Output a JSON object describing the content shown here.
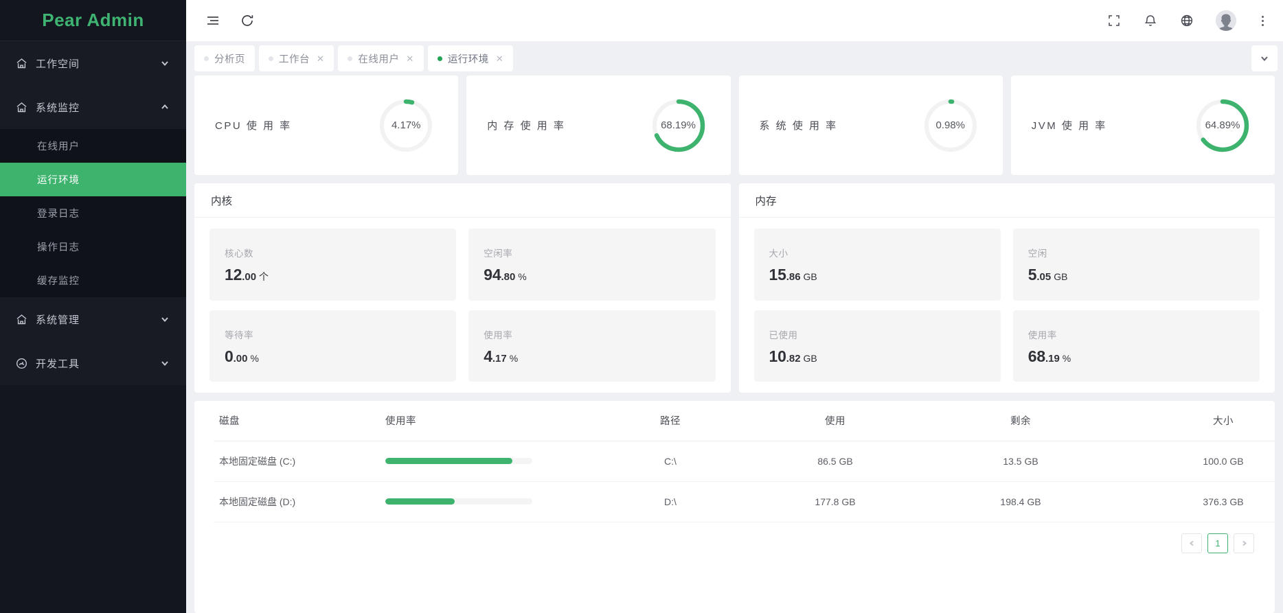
{
  "brand": {
    "name": "Pear Admin"
  },
  "sidebar": {
    "groups": [
      {
        "label": "工作空间",
        "icon": "home-icon",
        "expanded": false,
        "items": []
      },
      {
        "label": "系统监控",
        "icon": "home-icon",
        "expanded": true,
        "items": [
          {
            "label": "在线用户",
            "active": false
          },
          {
            "label": "运行环境",
            "active": true
          },
          {
            "label": "登录日志",
            "active": false
          },
          {
            "label": "操作日志",
            "active": false
          },
          {
            "label": "缓存监控",
            "active": false
          }
        ]
      },
      {
        "label": "系统管理",
        "icon": "home-icon",
        "expanded": false,
        "items": []
      },
      {
        "label": "开发工具",
        "icon": "dashboard-icon",
        "expanded": false,
        "items": []
      }
    ]
  },
  "topbar": {
    "left_icons": [
      {
        "name": "menu-collapse-icon"
      },
      {
        "name": "refresh-icon"
      }
    ],
    "right_icons": [
      {
        "name": "fullscreen-icon"
      },
      {
        "name": "bell-icon"
      },
      {
        "name": "globe-icon"
      },
      {
        "name": "avatar"
      },
      {
        "name": "more-vertical-icon"
      }
    ]
  },
  "tabs": {
    "items": [
      {
        "label": "分析页",
        "closable": false,
        "active": false
      },
      {
        "label": "工作台",
        "closable": true,
        "active": false
      },
      {
        "label": "在线用户",
        "closable": true,
        "active": false
      },
      {
        "label": "运行环境",
        "closable": true,
        "active": true
      }
    ],
    "close_glyph": "✕",
    "more_icon": "chevron-down-icon"
  },
  "gauges": [
    {
      "title": "CPU 使 用 率",
      "value": 4.17,
      "display": "4.17%"
    },
    {
      "title": "内 存 使 用 率",
      "value": 68.19,
      "display": "68.19%"
    },
    {
      "title": "系 统 使 用 率",
      "value": 0.98,
      "display": "0.98%"
    },
    {
      "title": "JVM 使 用 率",
      "value": 64.89,
      "display": "64.89%"
    }
  ],
  "panels": [
    {
      "title": "内核",
      "stats": [
        {
          "label": "核心数",
          "big": "12",
          "small": ".00",
          "unit": "个"
        },
        {
          "label": "空闲率",
          "big": "94",
          "small": ".80",
          "unit": "%"
        },
        {
          "label": "等待率",
          "big": "0",
          "small": ".00",
          "unit": "%"
        },
        {
          "label": "使用率",
          "big": "4",
          "small": ".17",
          "unit": "%"
        }
      ]
    },
    {
      "title": "内存",
      "stats": [
        {
          "label": "大小",
          "big": "15",
          "small": ".86",
          "unit": "GB"
        },
        {
          "label": "空闲",
          "big": "5",
          "small": ".05",
          "unit": "GB"
        },
        {
          "label": "已使用",
          "big": "10",
          "small": ".82",
          "unit": "GB"
        },
        {
          "label": "使用率",
          "big": "68",
          "small": ".19",
          "unit": "%"
        }
      ]
    }
  ],
  "disk_table": {
    "columns": [
      "磁盘",
      "使用率",
      "路径",
      "使用",
      "剩余",
      "大小"
    ],
    "rows": [
      {
        "disk": "本地固定磁盘 (C:)",
        "usage_pct": 86.5,
        "path": "C:\\",
        "used": "86.5 GB",
        "free": "13.5 GB",
        "size": "100.0 GB"
      },
      {
        "disk": "本地固定磁盘 (D:)",
        "usage_pct": 47.2,
        "path": "D:\\",
        "used": "177.8 GB",
        "free": "198.4 GB",
        "size": "376.3 GB"
      }
    ]
  },
  "pagination": {
    "prev_icon": "chevron-left-icon",
    "next_icon": "chevron-right-icon",
    "current_page": "1"
  },
  "colors": {
    "accent_green": "#3db36e",
    "sidebar_bg": "#14161f",
    "sidebar_sub_bg": "#101219",
    "page_bg": "#eff0f4",
    "track_gray": "#f2f2f3"
  }
}
